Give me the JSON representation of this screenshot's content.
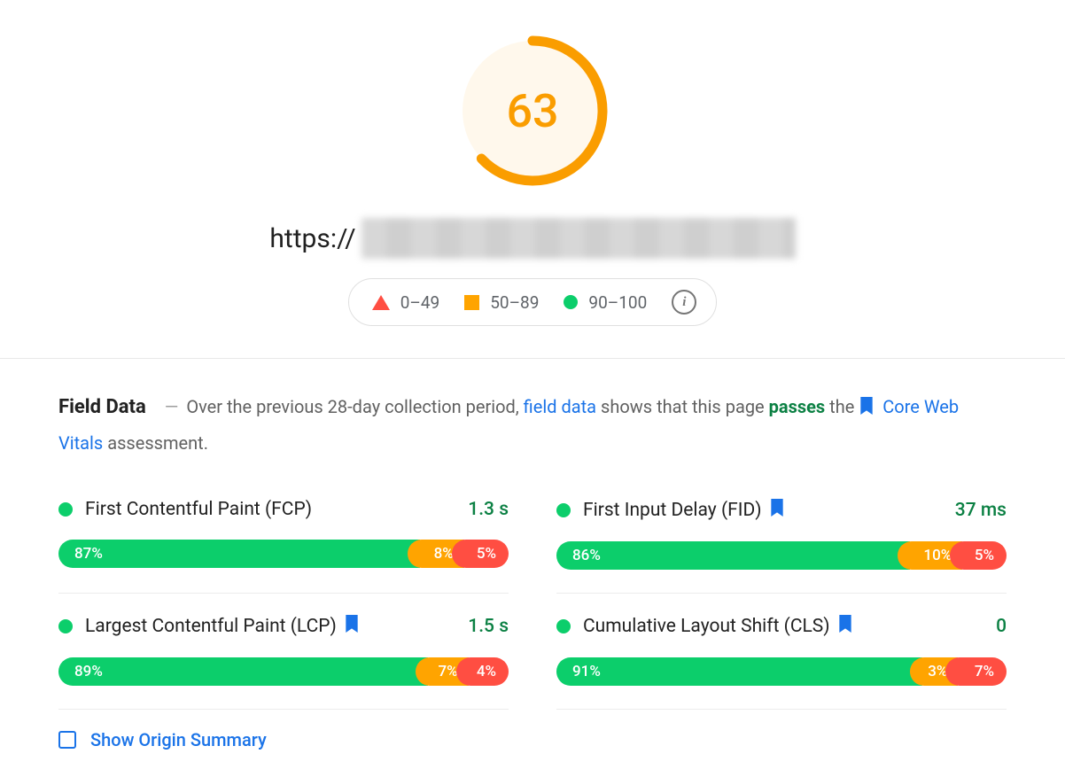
{
  "gauge": {
    "score": "63",
    "percent": 63,
    "color": "#fa9d00"
  },
  "url_prefix": "https://",
  "legend": {
    "poor": "0–49",
    "avg": "50–89",
    "good": "90–100"
  },
  "field_data": {
    "title": "Field Data",
    "pre": "Over the previous 28-day collection period, ",
    "link1": "field data",
    "mid": " shows that this page ",
    "passes": "passes",
    "post": " the ",
    "cwv": "Core Web Vitals",
    "tail": " assessment."
  },
  "metrics": [
    {
      "name": "First Contentful Paint (FCP)",
      "value": "1.3 s",
      "good": "87%",
      "avg": "8%",
      "poor": "5%",
      "bookmark": false,
      "w": {
        "g": 83,
        "o": 13,
        "r": 13
      }
    },
    {
      "name": "First Input Delay (FID)",
      "value": "37 ms",
      "good": "86%",
      "avg": "10%",
      "poor": "5%",
      "bookmark": true,
      "w": {
        "g": 82,
        "o": 15,
        "r": 13
      }
    },
    {
      "name": "Largest Contentful Paint (LCP)",
      "value": "1.5 s",
      "good": "89%",
      "avg": "7%",
      "poor": "4%",
      "bookmark": true,
      "w": {
        "g": 85,
        "o": 12,
        "r": 12
      }
    },
    {
      "name": "Cumulative Layout Shift (CLS)",
      "value": "0",
      "good": "91%",
      "avg": "3%",
      "poor": "7%",
      "bookmark": true,
      "w": {
        "g": 85,
        "o": 11,
        "r": 14
      }
    }
  ],
  "origin_summary_label": "Show Origin Summary"
}
